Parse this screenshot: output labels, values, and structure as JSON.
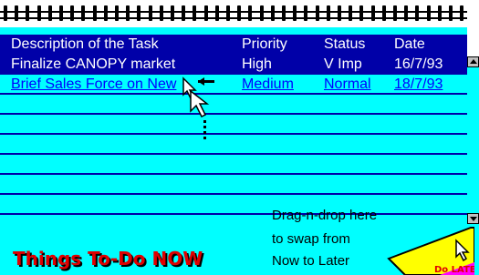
{
  "columns": {
    "description": "Description of the Task",
    "priority": "Priority",
    "status": "Status",
    "date": "Date"
  },
  "tasks": [
    {
      "description": "Finalize CANOPY market",
      "priority": "High",
      "status": "V Imp",
      "date": "16/7/93",
      "selected": true
    },
    {
      "description": "Brief Sales Force on New",
      "priority": "Medium",
      "status": "Normal",
      "date": "18/7/93",
      "selected": false
    }
  ],
  "hint_lines": [
    "Drag-n-drop here",
    "to swap from",
    "Now to Later"
  ],
  "now_label": "Things To-Do NOW",
  "later_label": "Do LATER",
  "colors": {
    "pad": "#00ffff",
    "header": "#0000a8",
    "link": "#0000ff",
    "now_label": "#e00000",
    "later_tab": "#ffff00"
  }
}
